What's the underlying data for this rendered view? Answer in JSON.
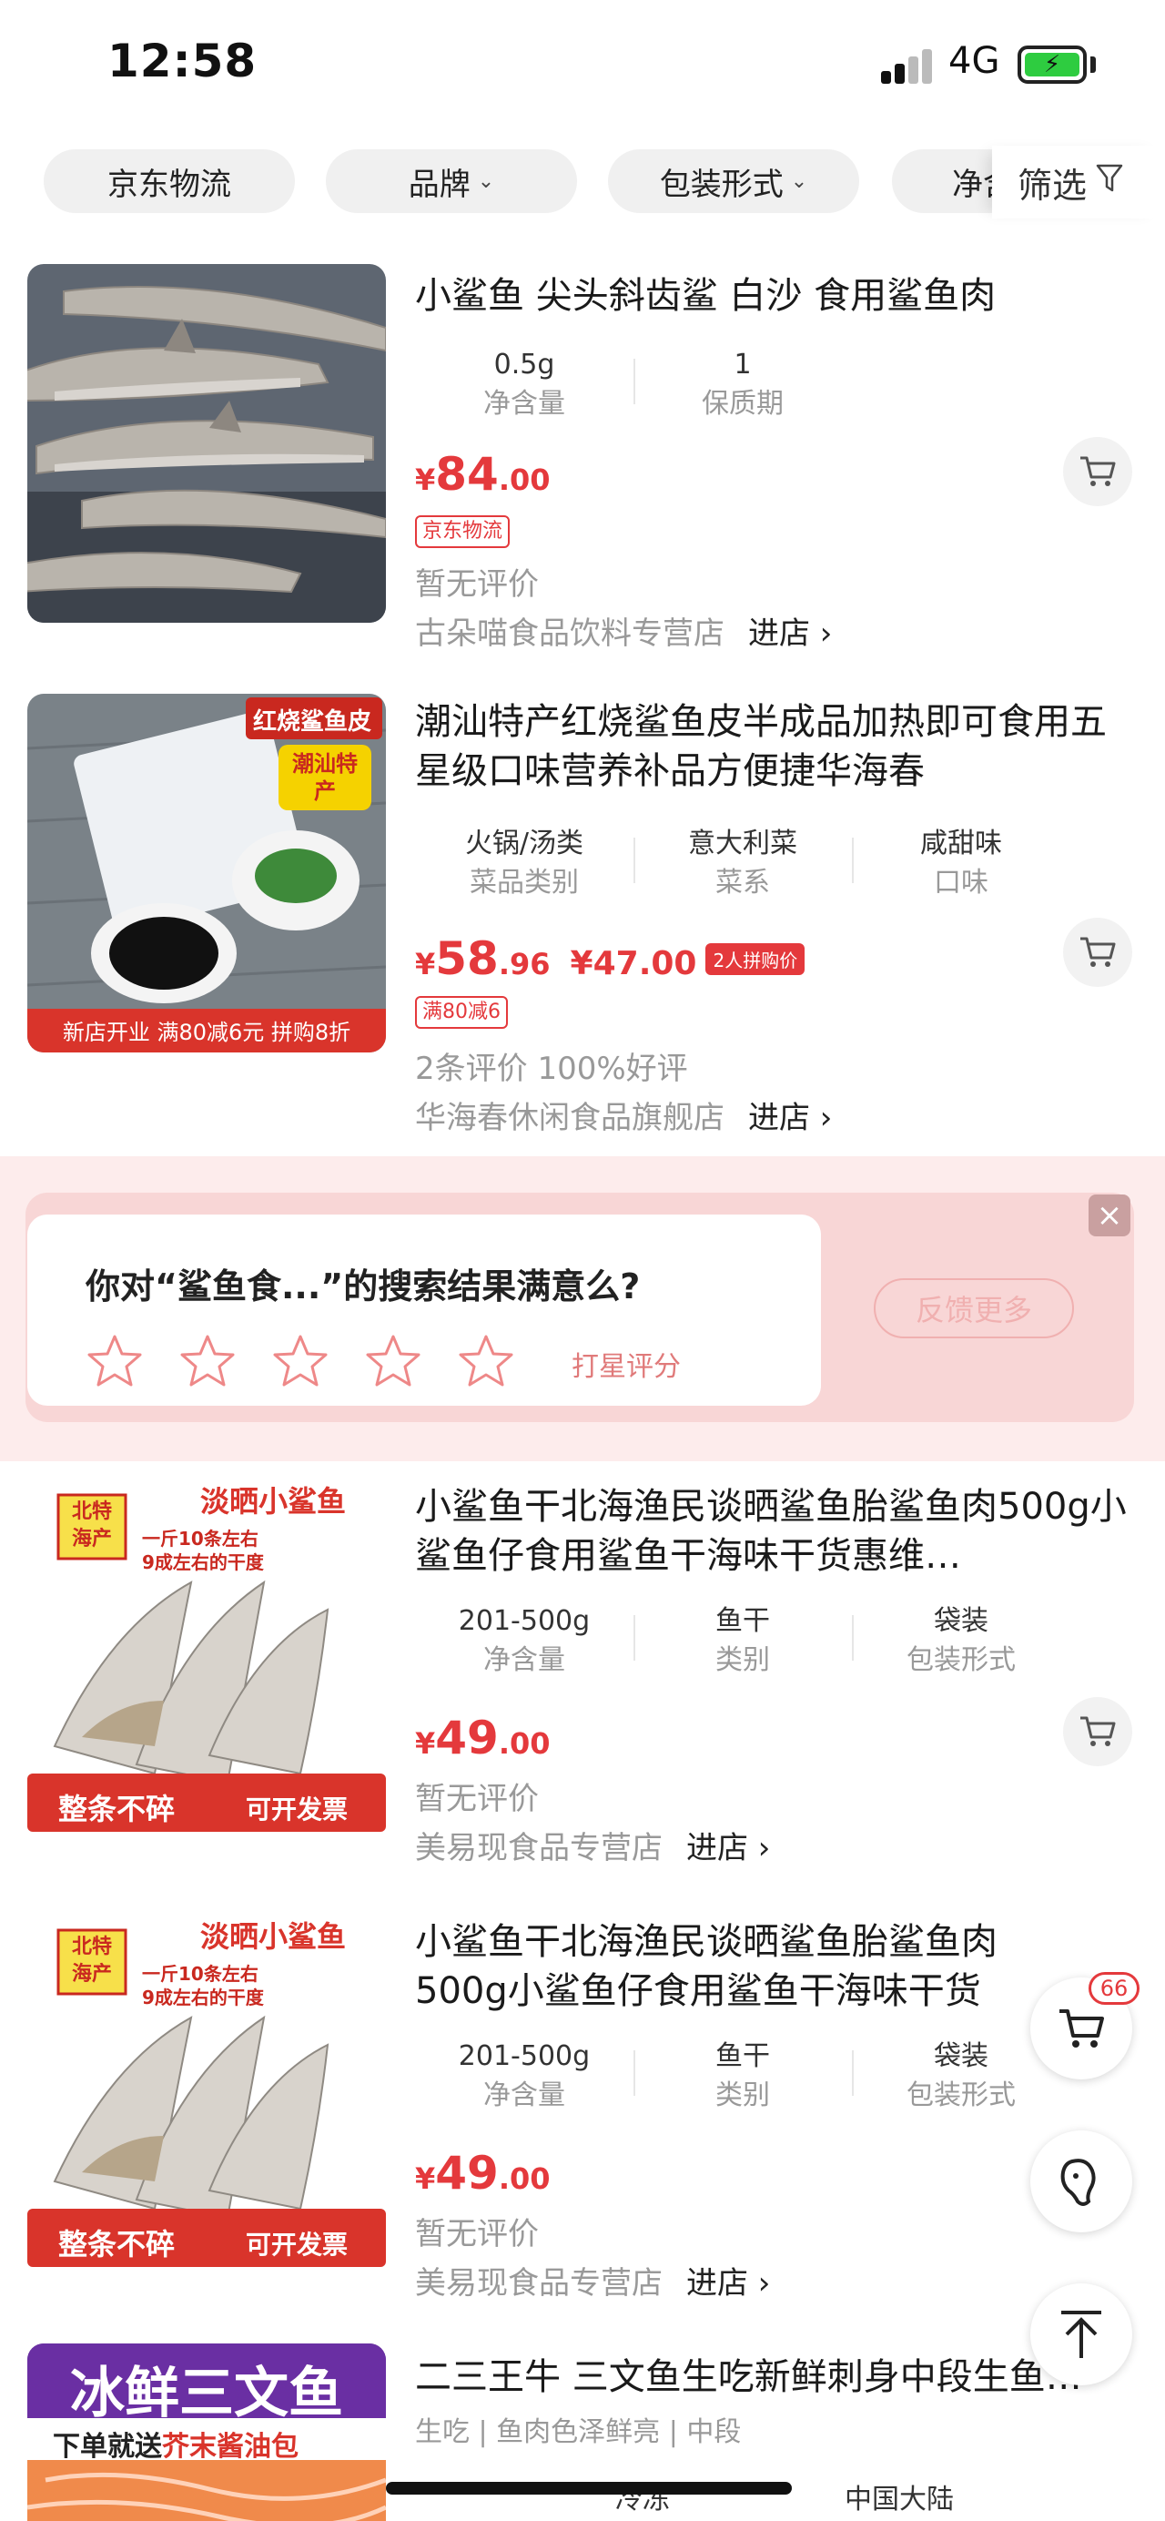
{
  "status_bar": {
    "time": "12:58",
    "network": "4G"
  },
  "filters": {
    "chips": [
      {
        "label": "京东物流",
        "has_caret": false
      },
      {
        "label": "品牌",
        "has_caret": true
      },
      {
        "label": "包装形式",
        "has_caret": true
      },
      {
        "label": "净含量",
        "has_caret": false
      }
    ],
    "filter_label": "筛选"
  },
  "products": [
    {
      "title": "小鲨鱼 尖头斜齿鲨 白沙 食用鲨鱼肉",
      "attrs": [
        {
          "value": "0.5g",
          "key": "净含量"
        },
        {
          "value": "1",
          "key": "保质期"
        }
      ],
      "price": {
        "currency": "¥",
        "int": "84",
        "dec": ".00"
      },
      "tag": "京东物流",
      "review": "暂无评价",
      "shop": "古朵喵食品饮料专营店",
      "enter": "进店 ›"
    },
    {
      "title": "潮汕特产红烧鲨鱼皮半成品加热即可食用五星级口味营养补品方便捷华海春",
      "attrs": [
        {
          "value": "火锅/汤类",
          "key": "菜品类别"
        },
        {
          "value": "意大利菜",
          "key": "菜系"
        },
        {
          "value": "咸甜味",
          "key": "口味"
        }
      ],
      "price": {
        "currency": "¥",
        "int": "58",
        "dec": ".96"
      },
      "group_price": "¥47.00",
      "group_tag": "2人拼购价",
      "tag": "满80减6",
      "review": "2条评价  100%好评",
      "shop": "华海春休闲食品旗舰店",
      "enter": "进店 ›",
      "thumb_banner": "新店开业  满80减6元  拼购8折",
      "thumb_corner": "红烧鲨鱼皮",
      "thumb_sticker": "潮汕特产"
    },
    {
      "title": "小鲨鱼干北海渔民谈晒鲨鱼胎鲨鱼肉500g小鲨鱼仔食用鲨鱼干海味干货惠维…",
      "attrs": [
        {
          "value": "201-500g",
          "key": "净含量"
        },
        {
          "value": "鱼干",
          "key": "类别"
        },
        {
          "value": "袋装",
          "key": "包装形式"
        }
      ],
      "price": {
        "currency": "¥",
        "int": "49",
        "dec": ".00"
      },
      "review": "暂无评价",
      "shop": "美易现食品专营店",
      "enter": "进店 ›",
      "thumb_title": "淡晒小鲨鱼",
      "thumb_badge": "北特\n海产",
      "thumb_sub1": "一斤10条左右",
      "thumb_sub2": "9成左右的干度",
      "thumb_left": "整条不碎",
      "thumb_right": "可开发票"
    },
    {
      "title": "小鲨鱼干北海渔民谈晒鲨鱼胎鲨鱼肉500g小鲨鱼仔食用鲨鱼干海味干货惠",
      "attrs": [
        {
          "value": "201-500g",
          "key": "净含量"
        },
        {
          "value": "鱼干",
          "key": "类别"
        },
        {
          "value": "袋装",
          "key": "包装形式"
        }
      ],
      "price": {
        "currency": "¥",
        "int": "49",
        "dec": ".00"
      },
      "review": "暂无评价",
      "shop": "美易现食品专营店",
      "enter": "进店 ›",
      "thumb_title": "淡晒小鲨鱼",
      "thumb_badge": "北特\n海产",
      "thumb_sub1": "一斤10条左右",
      "thumb_sub2": "9成左右的干度",
      "thumb_left": "整条不碎",
      "thumb_right": "可开发票"
    },
    {
      "title": "二三王牛 三文鱼生吃新鲜刺身中段生鱼…",
      "subline": "生吃 | 鱼肉色泽鲜亮 | 中段",
      "attrs_partial": [
        "冷冻",
        "中国大陆"
      ],
      "thumb_title": "冰鲜三文鱼",
      "thumb_promo_a": "下单就送",
      "thumb_promo_b": "芥末酱油包"
    }
  ],
  "feedback": {
    "question": "你对“鲨鱼食...”的搜索结果满意么?",
    "rate_label": "打星评分",
    "more_button": "反馈更多",
    "close": "×"
  },
  "floating": {
    "cart_badge": "66"
  },
  "colors": {
    "accent": "#e4393c",
    "chip_bg": "#f0f0f0",
    "feedback_bg": "#fdecec"
  }
}
